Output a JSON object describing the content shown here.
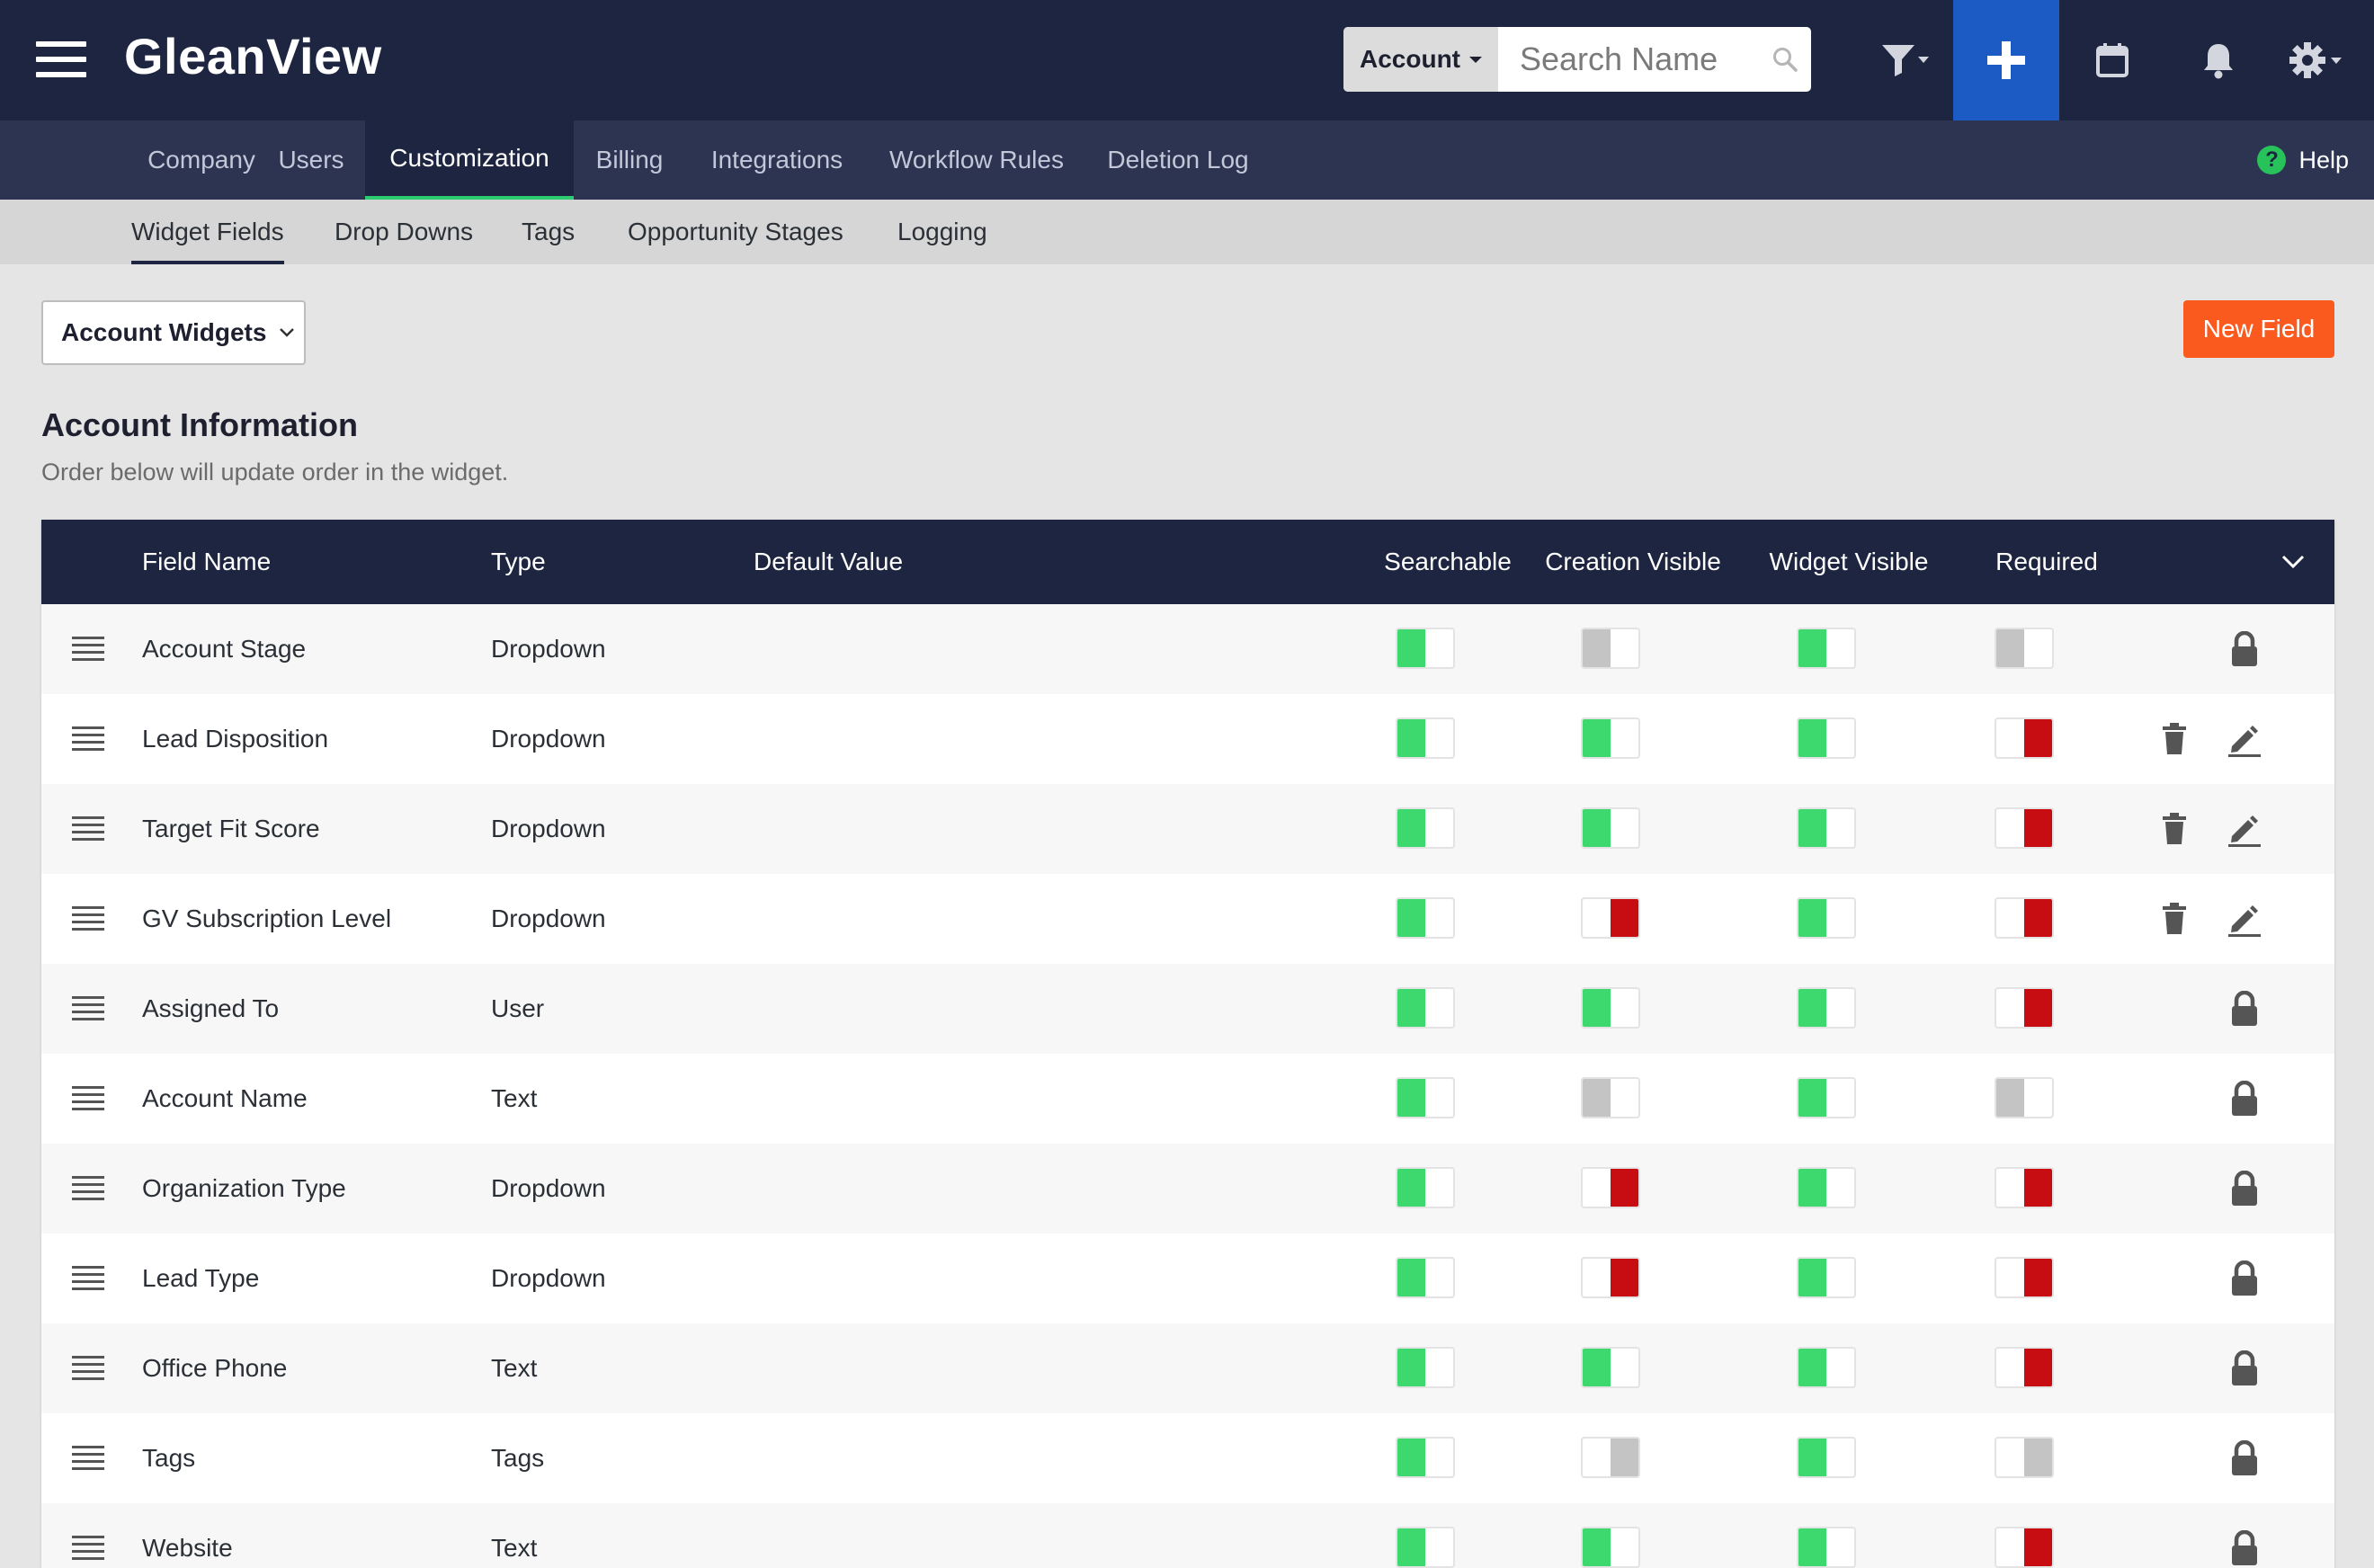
{
  "app": {
    "title": "GleanView"
  },
  "search": {
    "scope": "Account",
    "placeholder": "Search Name"
  },
  "nav": {
    "tabs": [
      {
        "label": "Company"
      },
      {
        "label": "Users"
      },
      {
        "label": "Customization",
        "active": true
      },
      {
        "label": "Billing"
      },
      {
        "label": "Integrations"
      },
      {
        "label": "Workflow Rules"
      },
      {
        "label": "Deletion Log"
      }
    ],
    "help_label": "Help"
  },
  "subnav": {
    "tabs": [
      {
        "label": "Widget Fields",
        "active": true
      },
      {
        "label": "Drop Downs"
      },
      {
        "label": "Tags"
      },
      {
        "label": "Opportunity Stages"
      },
      {
        "label": "Logging"
      }
    ]
  },
  "controls": {
    "widget_select": "Account Widgets",
    "new_field_label": "New Field"
  },
  "section": {
    "title": "Account Information",
    "subtitle": "Order below will update order in the widget."
  },
  "colors": {
    "on": "#3dd96f",
    "off": "#c70d12",
    "disabled": "#c4c4c4",
    "header": "#1d2540",
    "accent": "#fb5a1e",
    "plus": "#1c5bc4"
  },
  "table": {
    "columns": {
      "field_name": "Field Name",
      "type": "Type",
      "default_value": "Default Value",
      "searchable": "Searchable",
      "creation_visible": "Creation Visible",
      "widget_visible": "Widget Visible",
      "required": "Required"
    },
    "rows": [
      {
        "name": "Account Stage",
        "type": "Dropdown",
        "searchable": "on",
        "creation_visible": "disabled-off",
        "widget_visible": "on",
        "required": "disabled-off",
        "actions": "locked"
      },
      {
        "name": "Lead Disposition",
        "type": "Dropdown",
        "searchable": "on",
        "creation_visible": "on",
        "widget_visible": "on",
        "required": "off",
        "actions": "editable"
      },
      {
        "name": "Target Fit Score",
        "type": "Dropdown",
        "searchable": "on",
        "creation_visible": "on",
        "widget_visible": "on",
        "required": "off",
        "actions": "editable"
      },
      {
        "name": "GV Subscription Level",
        "type": "Dropdown",
        "searchable": "on",
        "creation_visible": "off",
        "widget_visible": "on",
        "required": "off",
        "actions": "editable"
      },
      {
        "name": "Assigned To",
        "type": "User",
        "searchable": "on",
        "creation_visible": "on",
        "widget_visible": "on",
        "required": "off",
        "actions": "locked"
      },
      {
        "name": "Account Name",
        "type": "Text",
        "searchable": "on",
        "creation_visible": "disabled-off",
        "widget_visible": "on",
        "required": "disabled-off",
        "actions": "locked"
      },
      {
        "name": "Organization Type",
        "type": "Dropdown",
        "searchable": "on",
        "creation_visible": "off",
        "widget_visible": "on",
        "required": "off",
        "actions": "locked"
      },
      {
        "name": "Lead Type",
        "type": "Dropdown",
        "searchable": "on",
        "creation_visible": "off",
        "widget_visible": "on",
        "required": "off",
        "actions": "locked"
      },
      {
        "name": "Office Phone",
        "type": "Text",
        "searchable": "on",
        "creation_visible": "on",
        "widget_visible": "on",
        "required": "off",
        "actions": "locked"
      },
      {
        "name": "Tags",
        "type": "Tags",
        "searchable": "on",
        "creation_visible": "disabled-on",
        "widget_visible": "on",
        "required": "disabled-on",
        "actions": "locked"
      },
      {
        "name": "Website",
        "type": "Text",
        "searchable": "on",
        "creation_visible": "on",
        "widget_visible": "on",
        "required": "off",
        "actions": "locked"
      }
    ]
  },
  "icons": {
    "menu": "hamburger-icon",
    "search": "search-icon",
    "filter": "filter-icon",
    "add": "plus-icon",
    "calendar": "calendar-icon",
    "notifications": "bell-icon",
    "settings": "gear-icon",
    "drag": "drag-handle-icon",
    "delete": "trash-icon",
    "edit": "pencil-icon",
    "lock": "lock-icon"
  }
}
